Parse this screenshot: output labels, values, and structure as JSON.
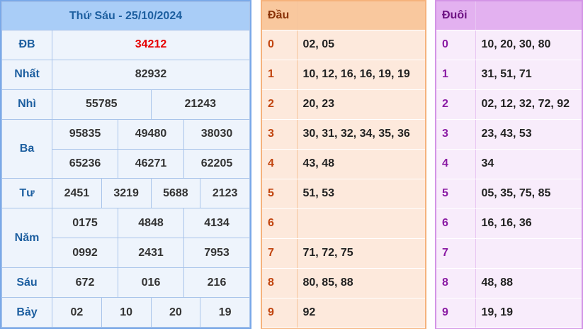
{
  "results": {
    "title": "Thứ Sáu - 25/10/2024",
    "labels": {
      "db": "ĐB",
      "nhat": "Nhất",
      "nhi": "Nhì",
      "ba": "Ba",
      "tu": "Tư",
      "nam": "Năm",
      "sau": "Sáu",
      "bay": "Bảy"
    },
    "db": "34212",
    "nhat": "82932",
    "nhi": [
      "55785",
      "21243"
    ],
    "ba": [
      "95835",
      "49480",
      "38030",
      "65236",
      "46271",
      "62205"
    ],
    "tu": [
      "2451",
      "3219",
      "5688",
      "2123"
    ],
    "nam": [
      "0175",
      "4848",
      "4134",
      "0992",
      "2431",
      "7953"
    ],
    "sau": [
      "672",
      "016",
      "216"
    ],
    "bay": [
      "02",
      "10",
      "20",
      "19"
    ]
  },
  "head_table": {
    "header": "Đầu",
    "rows": [
      {
        "digit": "0",
        "values": "02, 05"
      },
      {
        "digit": "1",
        "values": "10, 12, 16, 16, 19, 19"
      },
      {
        "digit": "2",
        "values": "20, 23"
      },
      {
        "digit": "3",
        "values": "30, 31, 32, 34, 35, 36"
      },
      {
        "digit": "4",
        "values": "43, 48"
      },
      {
        "digit": "5",
        "values": "51, 53"
      },
      {
        "digit": "6",
        "values": ""
      },
      {
        "digit": "7",
        "values": "71, 72, 75"
      },
      {
        "digit": "8",
        "values": "80, 85, 88"
      },
      {
        "digit": "9",
        "values": "92"
      }
    ]
  },
  "tail_table": {
    "header": "Đuôi",
    "rows": [
      {
        "digit": "0",
        "values": "10, 20, 30, 80"
      },
      {
        "digit": "1",
        "values": "31, 51, 71"
      },
      {
        "digit": "2",
        "values": "02, 12, 32, 72, 92"
      },
      {
        "digit": "3",
        "values": "23, 43, 53"
      },
      {
        "digit": "4",
        "values": "34"
      },
      {
        "digit": "5",
        "values": "05, 35, 75, 85"
      },
      {
        "digit": "6",
        "values": "16, 16, 36"
      },
      {
        "digit": "7",
        "values": ""
      },
      {
        "digit": "8",
        "values": "48, 88"
      },
      {
        "digit": "9",
        "values": "19, 19"
      }
    ]
  },
  "colors": {
    "special_prize": "#e60000",
    "results_header": "#a9cdf7",
    "head_accent": "#f9c89e",
    "tail_accent": "#e3b1f0"
  }
}
